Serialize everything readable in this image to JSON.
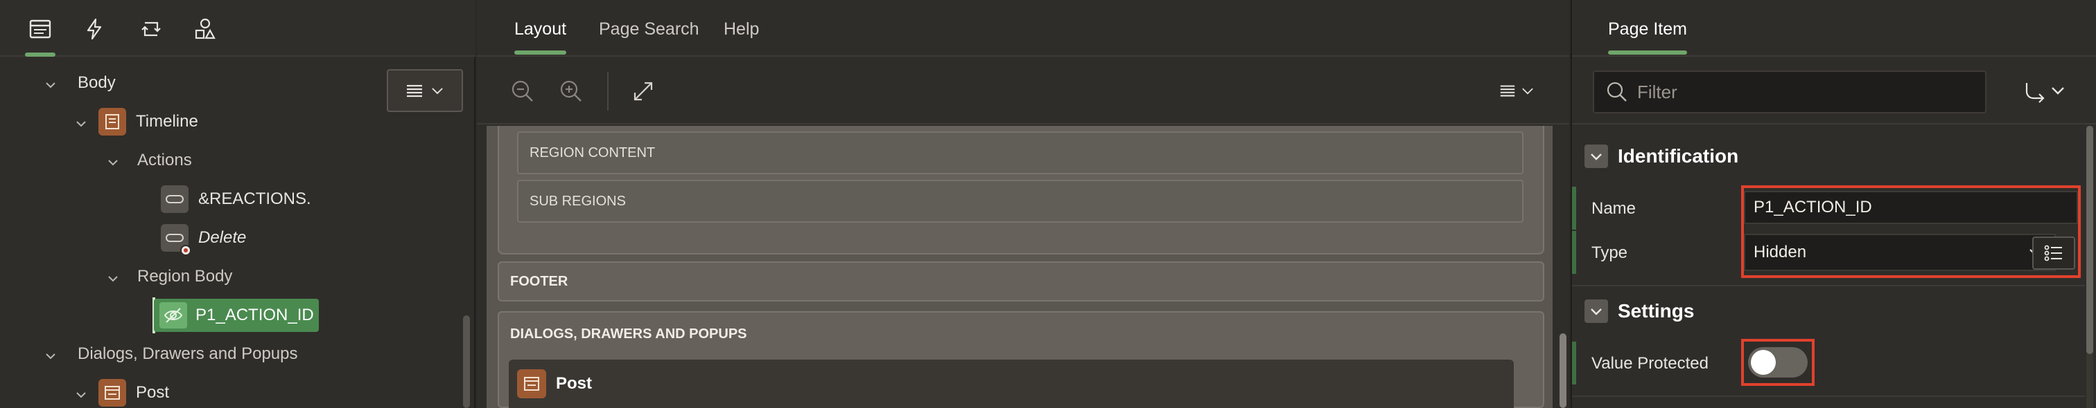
{
  "left_panel": {
    "tabs": [
      {
        "icon": "rendering-tree-icon",
        "active": true
      },
      {
        "icon": "dynamic-actions-icon",
        "active": false
      },
      {
        "icon": "processing-icon",
        "active": false
      },
      {
        "icon": "shared-components-icon",
        "active": false
      }
    ],
    "tree": {
      "body": "Body",
      "timeline": "Timeline",
      "actions": "Actions",
      "reactions_button": "&REACTIONS.",
      "delete_button": "Delete",
      "region_body": "Region Body",
      "p1_action_id": "P1_ACTION_ID",
      "dialogs": "Dialogs, Drawers and Popups",
      "post": "Post"
    },
    "menu_icon": "hamburger-menu-icon"
  },
  "center_panel": {
    "tabs": {
      "layout": "Layout",
      "page_search": "Page Search",
      "help": "Help"
    },
    "active_tab": "Layout",
    "toolbar_icons": [
      "zoom-out-icon",
      "zoom-in-icon",
      "expand-icon",
      "hamburger-menu-icon"
    ],
    "canvas": {
      "region_content": "REGION CONTENT",
      "sub_regions": "SUB REGIONS",
      "footer": "FOOTER",
      "dialogs": "DIALOGS, DRAWERS AND POPUPS",
      "post": "Post"
    }
  },
  "right_panel": {
    "tab": "Page Item",
    "filter": {
      "placeholder": "Filter",
      "value": ""
    },
    "goto_icon": "go-to-group-icon",
    "identification": {
      "title": "Identification",
      "name_label": "Name",
      "name_value": "P1_ACTION_ID",
      "type_label": "Type",
      "type_value": "Hidden"
    },
    "settings": {
      "title": "Settings",
      "value_protected_label": "Value Protected",
      "value_protected_on": false
    },
    "highlight_color": "#e0412c",
    "accent_color": "#6fa66a"
  }
}
